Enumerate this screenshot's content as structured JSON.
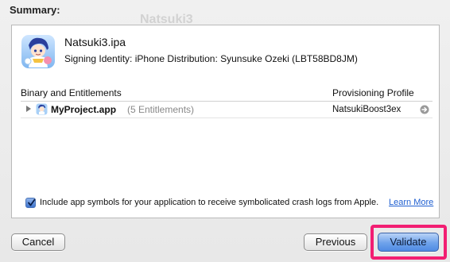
{
  "background": {
    "window_title": "Natsuki3"
  },
  "summary": {
    "heading": "Summary:"
  },
  "archive": {
    "ipa_name": "Natsuki3.ipa",
    "signing_identity": "Signing Identity: iPhone Distribution: Syunsuke Ozeki (LBT58BD8JM)",
    "icon": "app-character-icon"
  },
  "table": {
    "headers": {
      "binary": "Binary and Entitlements",
      "profile": "Provisioning Profile"
    },
    "rows": [
      {
        "name": "MyProject.app",
        "entitlements": "(5 Entitlements)",
        "profile": "NatsukiBoost3ex",
        "icon": "app-small-icon",
        "arrow_icon": "go-arrow-icon"
      }
    ]
  },
  "symbols": {
    "checked": true,
    "label": "Include app symbols for your application to receive symbolicated crash logs from Apple.",
    "link": "Learn More"
  },
  "buttons": {
    "cancel": "Cancel",
    "previous": "Previous",
    "validate": "Validate"
  },
  "colors": {
    "highlight": "#f21e72",
    "link": "#1f5fd0",
    "validate": "#6ea2eb"
  }
}
